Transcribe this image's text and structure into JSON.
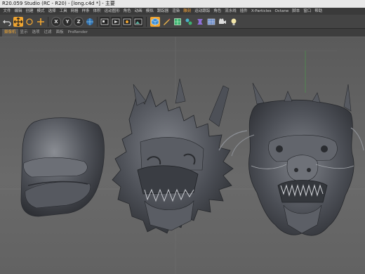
{
  "window": {
    "title": "R20.059 Studio (RC - R20) - [long.c4d *] - 主要"
  },
  "menu": {
    "items": [
      {
        "label": "文件",
        "highlight": false
      },
      {
        "label": "编辑",
        "highlight": false
      },
      {
        "label": "创建",
        "highlight": false
      },
      {
        "label": "模式",
        "highlight": false
      },
      {
        "label": "选择",
        "highlight": false
      },
      {
        "label": "工具",
        "highlight": false
      },
      {
        "label": "网格",
        "highlight": false
      },
      {
        "label": "样条",
        "highlight": false
      },
      {
        "label": "体积",
        "highlight": false
      },
      {
        "label": "运动图形",
        "highlight": false
      },
      {
        "label": "角色",
        "highlight": false
      },
      {
        "label": "动画",
        "highlight": false
      },
      {
        "label": "模拟",
        "highlight": false
      },
      {
        "label": "跟踪器",
        "highlight": false
      },
      {
        "label": "渲染",
        "highlight": false
      },
      {
        "label": "雕刻",
        "highlight": true
      },
      {
        "label": "运动跟踪",
        "highlight": false
      },
      {
        "label": "角色",
        "highlight": false
      },
      {
        "label": "流水线",
        "highlight": false
      },
      {
        "label": "插件",
        "highlight": false
      },
      {
        "label": "X-Particles",
        "highlight": false
      },
      {
        "label": "Octane",
        "highlight": false
      },
      {
        "label": "脚本",
        "highlight": false
      },
      {
        "label": "窗口",
        "highlight": false
      },
      {
        "label": "帮助",
        "highlight": false
      }
    ]
  },
  "toolbar": {
    "axis_x": "X",
    "axis_y": "Y",
    "axis_z": "Z",
    "icons": [
      "undo-icon",
      "move-icon",
      "rotate-icon",
      "scale-icon",
      "cube-icon",
      "pen-icon",
      "subdivision-icon",
      "mograph-icon",
      "deformer-icon",
      "environment-icon",
      "camera-icon",
      "light-icon"
    ]
  },
  "viewport_menu": {
    "items": [
      {
        "label": "摄像机",
        "active": true
      },
      {
        "label": "显示",
        "active": false
      },
      {
        "label": "选项",
        "active": false
      },
      {
        "label": "过滤",
        "active": false
      },
      {
        "label": "面板",
        "active": false
      },
      {
        "label": "ProRender",
        "active": false
      }
    ]
  },
  "colors": {
    "accent": "#f0a531",
    "viewport_bg": "#5f5f5f",
    "mesh": "#4f5258"
  }
}
